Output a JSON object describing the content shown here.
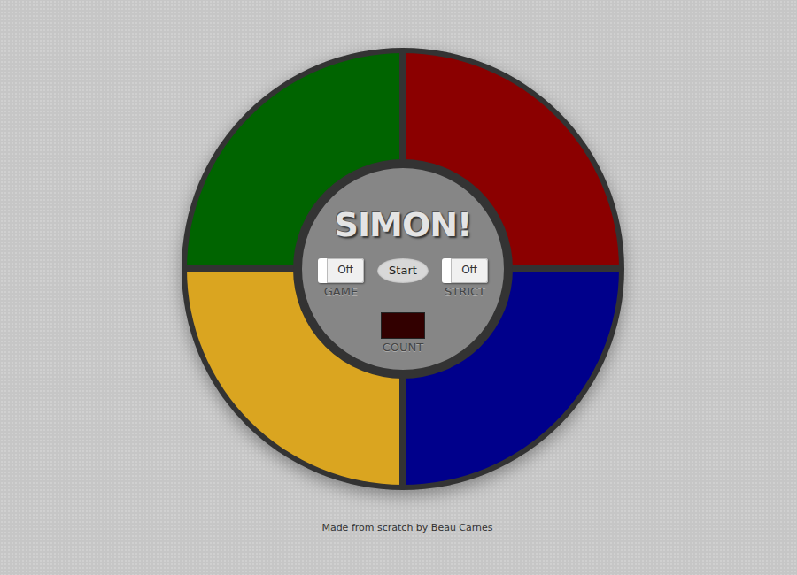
{
  "title": "SIMON!",
  "pads": [
    {
      "name": "green",
      "color": "#006400"
    },
    {
      "name": "red",
      "color": "#8b0000"
    },
    {
      "name": "yellow",
      "color": "#daa520"
    },
    {
      "name": "blue",
      "color": "#00008b"
    }
  ],
  "switches": [
    {
      "label": "GAME",
      "state_text": "Off",
      "on": false
    },
    {
      "label": "STRICT",
      "state_text": "Off",
      "on": false
    }
  ],
  "start": {
    "label": "Start"
  },
  "count": {
    "label": "COUNT"
  },
  "footer": "Made from scratch by Beau Carnes"
}
